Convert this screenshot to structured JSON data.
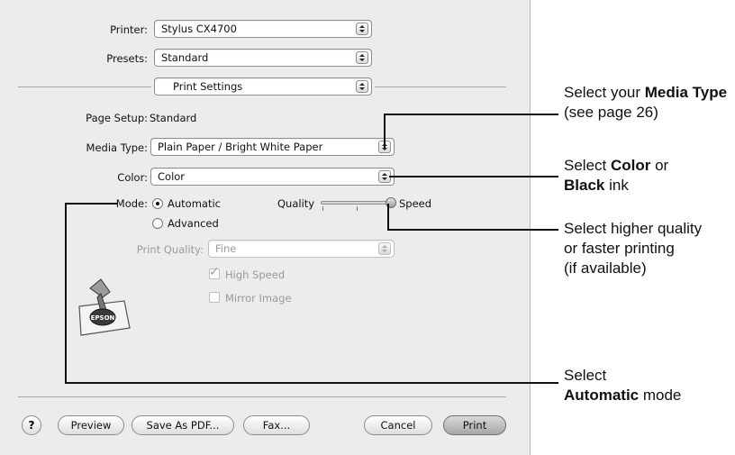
{
  "dialog": {
    "printer_label": "Printer:",
    "printer_value": "Stylus CX4700",
    "presets_label": "Presets:",
    "presets_value": "Standard",
    "panel_value": "Print Settings",
    "page_setup_label": "Page Setup:",
    "page_setup_value": "Standard",
    "media_type_label": "Media Type:",
    "media_type_value": "Plain Paper / Bright White Paper",
    "color_label": "Color:",
    "color_value": "Color",
    "mode_label": "Mode:",
    "mode_automatic": "Automatic",
    "mode_advanced": "Advanced",
    "mode_selected": "Automatic",
    "quality_label": "Quality",
    "speed_label": "Speed",
    "slider_level": 1.0,
    "print_quality_label": "Print Quality:",
    "print_quality_value": "Fine",
    "high_speed_label": "High Speed",
    "high_speed_checked": true,
    "mirror_image_label": "Mirror Image",
    "mirror_image_checked": false,
    "epson_logo_text": "EPSON",
    "buttons": {
      "help": "?",
      "preview": "Preview",
      "save_as_pdf": "Save As PDF...",
      "fax": "Fax...",
      "cancel": "Cancel",
      "print": "Print"
    }
  },
  "callouts": {
    "media_pre": "Select your ",
    "media_bold": "Media Type",
    "media_post": " (see page 26)",
    "color_pre": "Select ",
    "color_bold1": "Color",
    "color_mid": " or",
    "color_bold2": "Black",
    "color_post": " ink",
    "quality_line1": "Select higher quality",
    "quality_line2": "or faster printing",
    "quality_line3": "(if available)",
    "auto_line1": "Select",
    "auto_bold": "Automatic",
    "auto_post": " mode"
  },
  "colors": {
    "dialog_bg": "#ececec",
    "default_button": "#a6a6a6"
  }
}
